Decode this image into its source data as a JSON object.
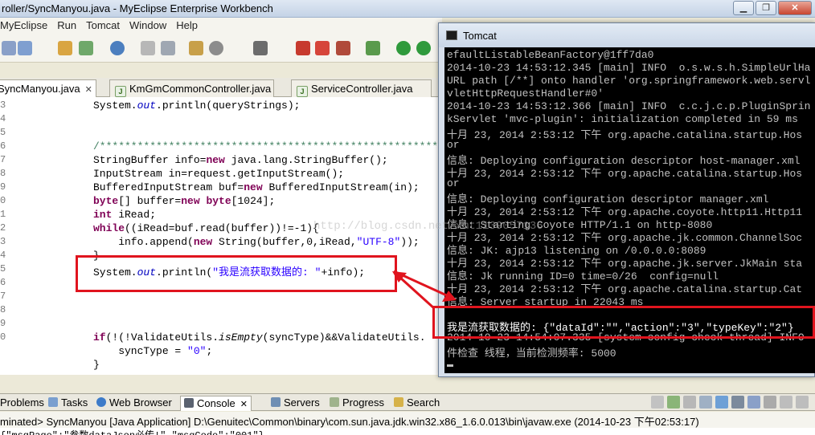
{
  "window": {
    "title": "roller/SyncManyou.java - MyEclipse Enterprise Workbench"
  },
  "menu": [
    "MyEclipse",
    "Run",
    "Tomcat",
    "Window",
    "Help"
  ],
  "editor_tabs": [
    {
      "label": "SyncManyou.java",
      "active": true,
      "close": "✕"
    },
    {
      "label": "KmGmCommonController.java",
      "active": false
    },
    {
      "label": "ServiceController.java",
      "active": false
    }
  ],
  "code": {
    "line_numbers": [
      "3",
      "4",
      "5",
      "6",
      "7",
      "8",
      "9",
      "0",
      "1",
      "2",
      "3",
      "4",
      "5",
      "6",
      "7",
      "8",
      "9",
      "0"
    ]
  },
  "views": {
    "tabs": [
      "Problems",
      "Tasks",
      "Web Browser",
      "Console",
      "Servers",
      "Progress",
      "Search"
    ],
    "active": "Console",
    "console_header": "minated> SyncManyou [Java Application] D:\\Genuitec\\Common\\binary\\com.sun.java.jdk.win32.x86_1.6.0.013\\bin\\javaw.exe (2014-10-23 下午02:53:17)",
    "console_output": "{\"msgPage\":\"参数dataJson必传!\",\"msgCode\":\"001\"}"
  },
  "tomcat": {
    "title": "Tomcat",
    "lines": [
      "efaultListableBeanFactory@1ff7da0",
      "2014-10-23 14:53:12.345 [main] INFO  o.s.w.s.h.SimpleUrlHa",
      "URL path [/**] onto handler 'org.springframework.web.servl",
      "vletHttpRequestHandler#0'",
      "2014-10-23 14:53:12.366 [main] INFO  c.c.j.c.p.PluginSprin",
      "kServlet 'mvc-plugin': initialization completed in 59 ms",
      "十月 23, 2014 2:53:12 下午 org.apache.catalina.startup.Hos",
      "or",
      "信息: Deploying configuration descriptor host-manager.xml",
      "十月 23, 2014 2:53:12 下午 org.apache.catalina.startup.Hos",
      "or",
      "信息: Deploying configuration descriptor manager.xml",
      "十月 23, 2014 2:53:12 下午 org.apache.coyote.http11.Http11",
      "信息: Starting Coyote HTTP/1.1 on http-8080",
      "十月 23, 2014 2:53:12 下午 org.apache.jk.common.ChannelSoc",
      "信息: JK: ajp13 listening on /0.0.0.0:8089",
      "十月 23, 2014 2:53:12 下午 org.apache.jk.server.JkMain sta",
      "信息: Jk running ID=0 time=0/26  config=null",
      "十月 23, 2014 2:53:12 下午 org.apache.catalina.startup.Cat",
      "信息: Server startup in 22043 ms",
      "",
      "我是流获取数据的: {\"dataId\":\"\",\"action\":\"3\",\"typeKey\":\"2\"}",
      "2014-10-23 14:54:07.335 [system config check thread] INFO",
      "件检查 线程，当前检测频率: 5000"
    ]
  },
  "watermark": "http://blog.csdn.net/xmt1139057136",
  "colors": {
    "annotation_red": "#e0141e",
    "console_bg": "#000000",
    "console_fg": "#c0c0c0",
    "java_keyword": "#7f0055",
    "java_string": "#2a00ff",
    "java_comment": "#3f7f5f"
  }
}
